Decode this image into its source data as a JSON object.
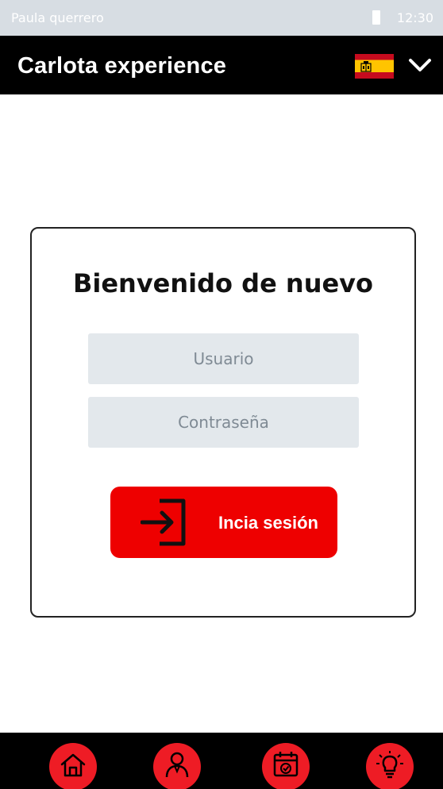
{
  "status_bar": {
    "carrier": "Paula querrero",
    "time": "12:30",
    "battery_icon": "battery-icon"
  },
  "header": {
    "title": "Carlota experience",
    "language_flag": "spain-flag-icon",
    "menu_icon": "chevron-down-icon"
  },
  "login": {
    "welcome": "Bienvenido de nuevo",
    "username_placeholder": "Usuario",
    "password_placeholder": "Contraseña",
    "submit_label": "Incia sesión",
    "submit_icon": "login-icon"
  },
  "bottom_nav": {
    "items": [
      {
        "icon": "home-icon"
      },
      {
        "icon": "user-icon"
      },
      {
        "icon": "calendar-check-icon"
      },
      {
        "icon": "lightbulb-icon"
      }
    ]
  },
  "colors": {
    "accent": "#ee0000",
    "nav_icon_bg": "#ee1c25",
    "header_bg": "#000000",
    "status_bar_bg": "#d7dde3",
    "input_bg": "#e3e8ec"
  }
}
